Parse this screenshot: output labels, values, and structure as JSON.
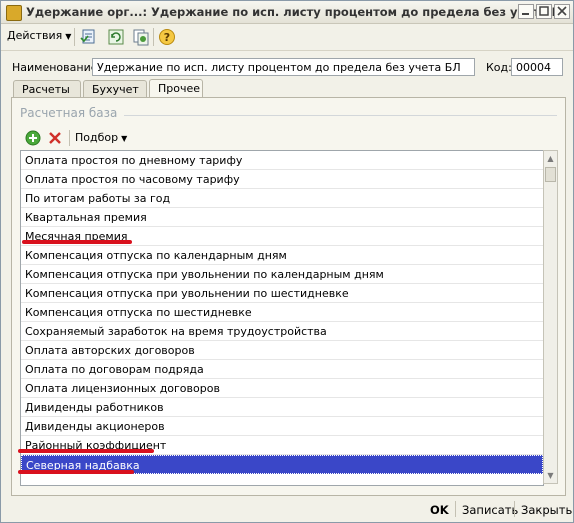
{
  "window": {
    "title": "Удержание орг...: Удержание по исп. листу процентом до предела без учета БЛ",
    "buttons": [
      "minimize-button",
      "maximize-button",
      "close-button"
    ]
  },
  "toolbar": {
    "actions_label": "Действия",
    "icons": [
      "post-document-icon",
      "refresh-icon",
      "copy-record-icon",
      "help-icon"
    ]
  },
  "form": {
    "name_label": "Наименование:",
    "name_value": "Удержание по исп. листу процентом до предела без учета БЛ",
    "code_label": "Код:",
    "code_value": "00004"
  },
  "tabs": [
    {
      "label": "Расчеты",
      "active": false
    },
    {
      "label": "Бухучет",
      "active": false
    },
    {
      "label": "Прочее",
      "active": true
    }
  ],
  "base_group": {
    "title": "Расчетная база",
    "list_toolbar": {
      "selection_label": "Подбор"
    },
    "items": [
      "Оплата простоя по дневному тарифу",
      "Оплата простоя по часовому тарифу",
      "По итогам работы за год",
      "Квартальная премия",
      "Месячная премия",
      "Компенсация отпуска по календарным дням",
      "Компенсация отпуска при увольнении по календарным дням",
      "Компенсация отпуска при увольнении по шестидневке",
      "Компенсация отпуска по шестидневке",
      "Сохраняемый заработок на время трудоустройства",
      "Оплата авторских договоров",
      "Оплата по договорам подряда",
      "Оплата лицензионных договоров",
      "Дивиденды работников",
      "Дивиденды акционеров",
      "Районный коэффициент",
      "Северная надбавка"
    ],
    "selected_item": "Северная надбавка",
    "highlighted_items": [
      "Месячная премия",
      "Районный коэффициент",
      "Северная надбавка"
    ],
    "highlight_color": "#d9111e",
    "selection_color": "#3a47c8"
  },
  "footer": {
    "ok_label": "OK",
    "save_label": "Записать",
    "close_label": "Закрыть"
  }
}
